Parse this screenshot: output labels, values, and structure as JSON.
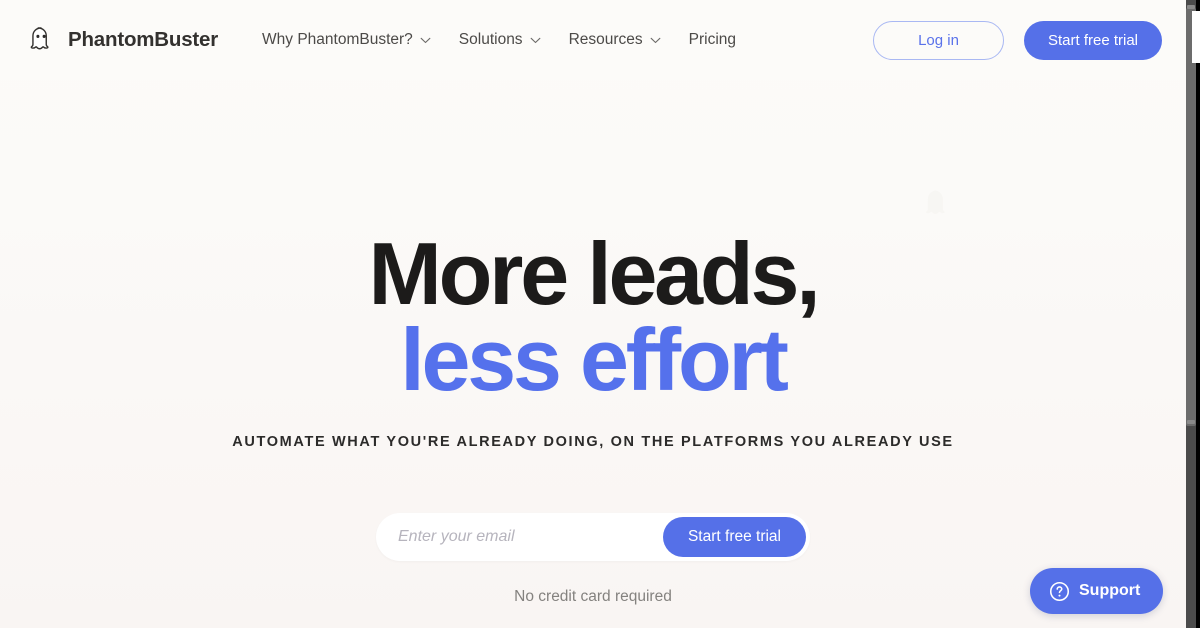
{
  "header": {
    "logo": {
      "icon": "ghost-icon",
      "name": "PhantomBuster"
    },
    "nav_items": [
      {
        "label": "Why PhantomBuster?",
        "has_chevron": true
      },
      {
        "label": "Solutions",
        "has_chevron": true
      },
      {
        "label": "Resources",
        "has_chevron": true
      },
      {
        "label": "Pricing",
        "has_chevron": false
      }
    ],
    "login_label": "Log in",
    "trial_label": "Start free trial"
  },
  "hero": {
    "headline_line1": "More leads,",
    "headline_line2": "less effort",
    "subheadline": "AUTOMATE WHAT YOU'RE ALREADY DOING, ON THE PLATFORMS YOU ALREADY USE",
    "email_placeholder": "Enter your email",
    "email_value": "",
    "cta_label": "Start free trial",
    "disclaimer": "No credit card required"
  },
  "support": {
    "icon": "question-circle-icon",
    "label": "Support"
  },
  "colors": {
    "accent_blue": "#5570e8",
    "headline_blue": "#5571ec",
    "headline_dark": "#1c1b1a",
    "page_background": "#fbfaf8",
    "muted_text": "#84827f",
    "placeholder_text": "#b6b4bd"
  }
}
